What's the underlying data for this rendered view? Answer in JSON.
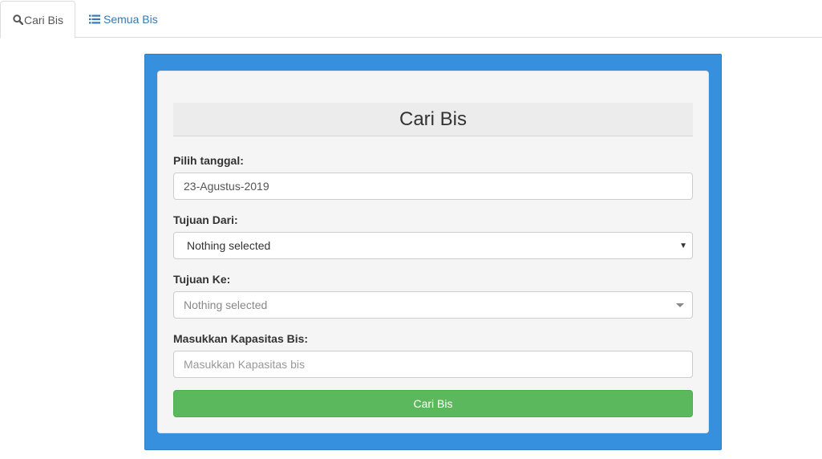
{
  "tabs": [
    {
      "label": "Cari Bis",
      "icon": "search-icon",
      "active": true
    },
    {
      "label": "Semua Bis",
      "icon": "list-icon",
      "active": false
    }
  ],
  "form": {
    "title": "Cari Bis",
    "date_label": "Pilih tanggal:",
    "date_value": "23-Agustus-2019",
    "from_label": "Tujuan Dari:",
    "from_value": "Nothing selected",
    "to_label": "Tujuan Ke:",
    "to_value": "Nothing selected",
    "capacity_label": "Masukkan Kapasitas Bis:",
    "capacity_placeholder": "Masukkan Kapasitas bis",
    "submit_label": "Cari Bis"
  },
  "colors": {
    "outer_background": "#3690de",
    "panel_background": "#f5f5f5",
    "button_green": "#5cb85c",
    "link_blue": "#337ab7"
  }
}
